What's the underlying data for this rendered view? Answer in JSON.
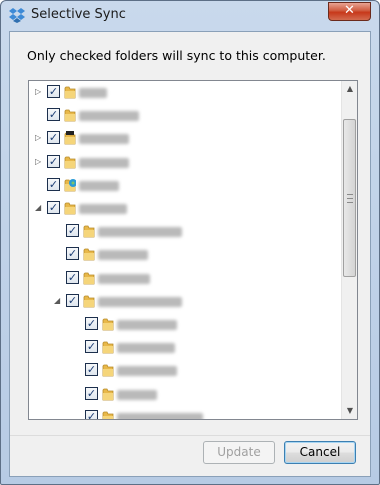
{
  "window": {
    "title": "Selective Sync",
    "close_label": "✕",
    "accent": "#3c7fb1",
    "close_color": "#c7381a"
  },
  "dialog": {
    "instruction": "Only checked folders will sync to this computer."
  },
  "tree": {
    "rows": [
      {
        "level": 0,
        "expander": "collapsed",
        "checked": true,
        "icon": "folder-icon"
      },
      {
        "level": 0,
        "expander": "none",
        "checked": true,
        "icon": "folder-icon"
      },
      {
        "level": 0,
        "expander": "collapsed",
        "checked": true,
        "icon": "shared-folder-icon"
      },
      {
        "level": 0,
        "expander": "collapsed",
        "checked": true,
        "icon": "folder-icon"
      },
      {
        "level": 0,
        "expander": "none",
        "checked": true,
        "icon": "public-folder-icon"
      },
      {
        "level": 0,
        "expander": "expanded",
        "checked": true,
        "icon": "folder-icon"
      },
      {
        "level": 1,
        "expander": "none",
        "checked": true,
        "icon": "folder-icon"
      },
      {
        "level": 1,
        "expander": "none",
        "checked": true,
        "icon": "folder-icon"
      },
      {
        "level": 1,
        "expander": "none",
        "checked": true,
        "icon": "folder-icon"
      },
      {
        "level": 1,
        "expander": "expanded",
        "checked": true,
        "icon": "folder-icon"
      },
      {
        "level": 2,
        "expander": "none",
        "checked": true,
        "icon": "folder-icon"
      },
      {
        "level": 2,
        "expander": "none",
        "checked": true,
        "icon": "folder-icon"
      },
      {
        "level": 2,
        "expander": "none",
        "checked": true,
        "icon": "folder-icon"
      },
      {
        "level": 2,
        "expander": "none",
        "checked": true,
        "icon": "folder-icon"
      },
      {
        "level": 2,
        "expander": "none",
        "checked": true,
        "icon": "folder-icon"
      }
    ]
  },
  "buttons": {
    "update_label": "Update",
    "update_enabled": false,
    "cancel_label": "Cancel"
  }
}
